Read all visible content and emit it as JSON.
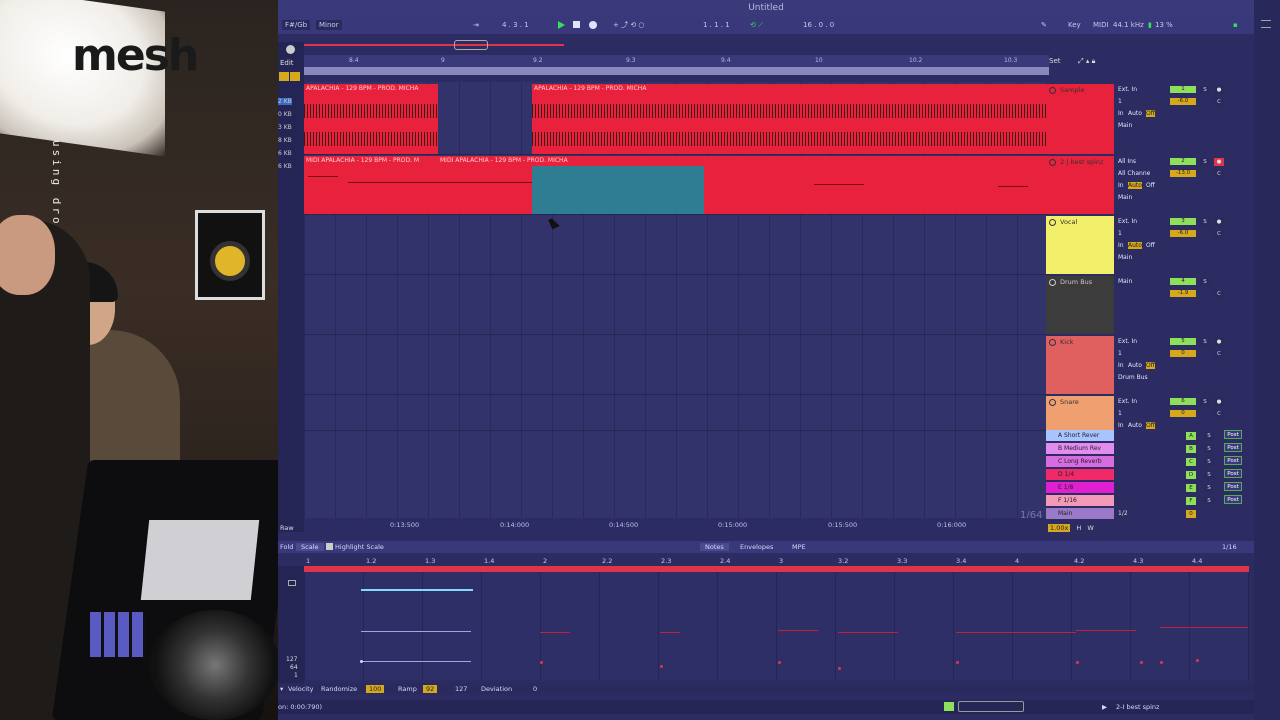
{
  "webcam": {
    "logo_text": "mesh",
    "watermark": "using droidcam.app"
  },
  "window": {
    "title": "Untitled"
  },
  "transport": {
    "key": "F#/Gb",
    "scale": "Minor",
    "signature": "4 . 3 . 1",
    "position": "1 . 1 . 1",
    "loop_length": "16 . 0 . 0",
    "key_label": "Key",
    "midi_label": "MIDI",
    "sample_rate": "44.1 kHz",
    "cpu": "13 %"
  },
  "left": {
    "edit_label": "Edit",
    "kb_labels": [
      "2 KB",
      "0 KB",
      "3 KB",
      "8 KB",
      "6 KB",
      "6 KB"
    ]
  },
  "ruler": {
    "bars": [
      "8.4",
      "9",
      "9.2",
      "9.3",
      "9.4",
      "10",
      "10.2",
      "10.3"
    ],
    "set_label": "Set"
  },
  "arrangement": {
    "clip_audio_1": "APALACHIA - 129 BPM - PROD. MICHA",
    "clip_audio_2": "APALACHIA - 129 BPM - PROD. MICHA",
    "clip_midi_1": "MIDI APALACHIA - 129 BPM - PROD. M",
    "clip_midi_2": "MIDI APALACHIA - 129 BPM - PROD. MICHA",
    "zoom": "1/64"
  },
  "time_ruler": {
    "raw_label": "Raw",
    "times": [
      "0:13:500",
      "0:14:000",
      "0:14:500",
      "0:15:000",
      "0:15:500",
      "0:16:000"
    ]
  },
  "tracks": [
    {
      "name": "Sample",
      "color": "#e8223c",
      "input": "Ext. In",
      "channel": "1",
      "monitor_in": "In",
      "monitor_auto": "Auto",
      "monitor_off": "Off",
      "output": "Main",
      "number": "1",
      "volume": "-6.0"
    },
    {
      "name": "2 | best spinz",
      "color": "#e8223c",
      "input": "All Ins",
      "channel": "All Channe",
      "monitor_in": "In",
      "monitor_auto": "Auto",
      "monitor_off": "Off",
      "output": "Main",
      "number": "2",
      "volume": "-13.0"
    },
    {
      "name": "Vocal",
      "color": "#f2f06a",
      "input": "Ext. In",
      "channel": "1",
      "monitor_in": "In",
      "monitor_auto": "Auto",
      "monitor_off": "Off",
      "output": "Main",
      "number": "3",
      "volume": "-6.0"
    },
    {
      "name": "Drum Bus",
      "color": "#3c3c3c",
      "input": "Main",
      "channel": "",
      "monitor_in": "",
      "monitor_auto": "",
      "monitor_off": "",
      "output": "",
      "number": "4",
      "volume": "-1.9"
    },
    {
      "name": "Kick",
      "color": "#e06060",
      "input": "Ext. In",
      "channel": "1",
      "monitor_in": "In",
      "monitor_auto": "Auto",
      "monitor_off": "Off",
      "output": "Drum Bus",
      "number": "5",
      "volume": "0"
    },
    {
      "name": "Snare",
      "color": "#f0a070",
      "input": "Ext. In",
      "channel": "1",
      "monitor_in": "In",
      "monitor_auto": "Auto",
      "monitor_off": "Off",
      "output": "",
      "number": "6",
      "volume": "0"
    }
  ],
  "returns": [
    {
      "name": "A Short Rever",
      "letter": "A",
      "color": "#a8c4ff"
    },
    {
      "name": "B Medium Rev",
      "letter": "B",
      "color": "#e28cf0"
    },
    {
      "name": "C Long Reverb",
      "letter": "C",
      "color": "#d66ce0"
    },
    {
      "name": "D 1/4",
      "letter": "D",
      "color": "#f02a6a"
    },
    {
      "name": "E 1/8",
      "letter": "E",
      "color": "#e020d0"
    },
    {
      "name": "F 1/16",
      "letter": "F",
      "color": "#f29ab8"
    }
  ],
  "main": {
    "name": "Main",
    "ratio": "1/2",
    "volume": "0",
    "post_label": "Post"
  },
  "master_bar": {
    "tempo": "1.00x",
    "h": "H",
    "w": "W"
  },
  "editor": {
    "fold_label": "Fold",
    "scale_label": "Scale",
    "highlight_label": "Highlight Scale",
    "tabs": [
      "Notes",
      "Envelopes",
      "MPE"
    ],
    "grid": "1/16",
    "bars": [
      "1",
      "1.2",
      "1.3",
      "1.4",
      "2",
      "2.2",
      "2.3",
      "2.4",
      "3",
      "3.2",
      "3.3",
      "3.4",
      "4",
      "4.2",
      "4.3",
      "4.4"
    ],
    "vel_ticks": [
      "127",
      "64",
      "1"
    ]
  },
  "velocity_bar": {
    "velocity_label": "Velocity",
    "randomize_label": "Randomize",
    "randomize_value": "100",
    "ramp_label": "Ramp",
    "ramp_value": "92",
    "ramp_end": "127",
    "deviation_label": "Deviation",
    "deviation_value": "0"
  },
  "status": {
    "left": "on: 0:00:790)",
    "track": "2-I best spinz"
  }
}
